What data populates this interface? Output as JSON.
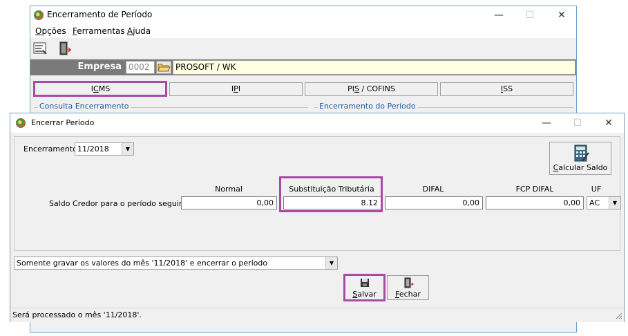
{
  "back_window": {
    "title": "Encerramento de Período",
    "controls": {
      "minimize": "—",
      "maximize": "☐",
      "close": "✕"
    },
    "menu": [
      {
        "label": "Opções",
        "underline": "O"
      },
      {
        "label": "Ferramentas",
        "underline": "F"
      },
      {
        "label": "Ajuda",
        "underline": "A"
      }
    ],
    "toolbar": [
      {
        "icon": "report-icon"
      },
      {
        "icon": "exit-door-icon"
      }
    ],
    "empresa": {
      "label": "Empresa",
      "code": "0002",
      "name": "PROSOFT / WK"
    },
    "tabs": [
      {
        "label": "ICMS",
        "underline_char": "C"
      },
      {
        "label": "IPI",
        "underline_char": "P"
      },
      {
        "label": "PIS / COFINS",
        "underline_char": "S"
      },
      {
        "label": "ISS",
        "underline_char": "I"
      }
    ],
    "groups": {
      "left": "Consulta Encerramento",
      "right": "Encerramento do Período"
    }
  },
  "front_window": {
    "title": "Encerrar Período",
    "controls": {
      "minimize": "—",
      "maximize": "☐",
      "close": "✕"
    },
    "encerramento": {
      "label": "Encerramento",
      "value": "11/2018"
    },
    "calcular_saldo": {
      "label": "Calcular Saldo",
      "icon": "calculator-icon"
    },
    "columns": {
      "normal": "Normal",
      "st": "Substituição Tributária",
      "difal": "DIFAL",
      "fcp_difal": "FCP DIFAL",
      "uf": "UF"
    },
    "row_label": "Saldo Credor para o período seguinte",
    "values": {
      "normal": "0,00",
      "st": "8.12",
      "difal": "0,00",
      "fcp_difal": "0,00",
      "uf": "AC"
    },
    "option_select": "Somente gravar os valores do mês '11/2018' e encerrar o período",
    "salvar": {
      "label": "Salvar",
      "icon": "floppy-disk-icon"
    },
    "fechar": {
      "label": "Fechar",
      "icon": "exit-door-icon"
    },
    "status": "Será processado o mês '11/2018'."
  },
  "colors": {
    "highlight": "#a64ca6",
    "group_caption": "#1a5aa6",
    "empresa_bar": "#7a7a7a",
    "empresa_name_bg": "#ffffe1"
  }
}
